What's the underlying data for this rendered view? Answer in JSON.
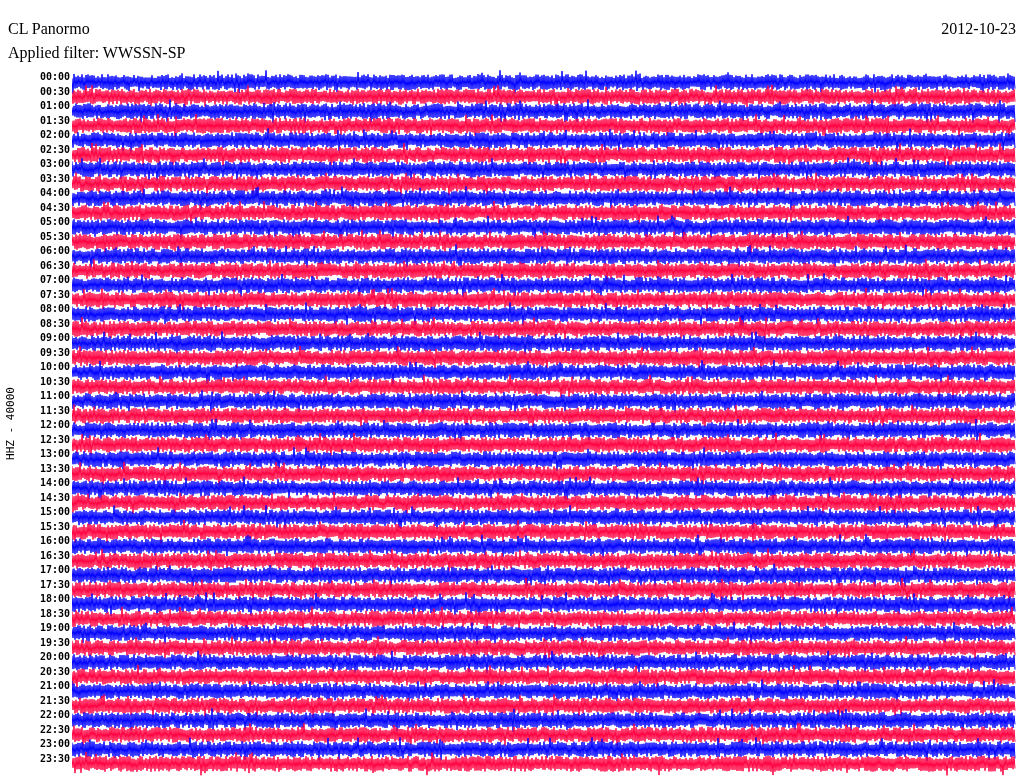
{
  "header": {
    "station": "CL Panormo",
    "date": "2012-10-23",
    "filter": "Applied filter: WWSSN-SP"
  },
  "axis_label": "HHZ - 40000",
  "rows": [
    {
      "label": "00:00",
      "color": "#0000ff"
    },
    {
      "label": "00:30",
      "color": "#ff0040"
    },
    {
      "label": "01:00",
      "color": "#0000ff"
    },
    {
      "label": "01:30",
      "color": "#ff0040"
    },
    {
      "label": "02:00",
      "color": "#0000ff"
    },
    {
      "label": "02:30",
      "color": "#ff0040"
    },
    {
      "label": "03:00",
      "color": "#0000ff"
    },
    {
      "label": "03:30",
      "color": "#ff0040"
    },
    {
      "label": "04:00",
      "color": "#0000ff"
    },
    {
      "label": "04:30",
      "color": "#ff0040"
    },
    {
      "label": "05:00",
      "color": "#0000ff"
    },
    {
      "label": "05:30",
      "color": "#ff0040"
    },
    {
      "label": "06:00",
      "color": "#0000ff"
    },
    {
      "label": "06:30",
      "color": "#ff0040"
    },
    {
      "label": "07:00",
      "color": "#0000ff"
    },
    {
      "label": "07:30",
      "color": "#ff0040"
    },
    {
      "label": "08:00",
      "color": "#0000ff"
    },
    {
      "label": "08:30",
      "color": "#ff0040"
    },
    {
      "label": "09:00",
      "color": "#0000ff"
    },
    {
      "label": "09:30",
      "color": "#ff0040"
    },
    {
      "label": "10:00",
      "color": "#0000ff"
    },
    {
      "label": "10:30",
      "color": "#ff0040"
    },
    {
      "label": "11:00",
      "color": "#0000ff"
    },
    {
      "label": "11:30",
      "color": "#ff0040"
    },
    {
      "label": "12:00",
      "color": "#0000ff"
    },
    {
      "label": "12:30",
      "color": "#ff0040"
    },
    {
      "label": "13:00",
      "color": "#0000ff"
    },
    {
      "label": "13:30",
      "color": "#ff0040"
    },
    {
      "label": "14:00",
      "color": "#0000ff"
    },
    {
      "label": "14:30",
      "color": "#ff0040"
    },
    {
      "label": "15:00",
      "color": "#0000ff"
    },
    {
      "label": "15:30",
      "color": "#ff0040"
    },
    {
      "label": "16:00",
      "color": "#0000ff"
    },
    {
      "label": "16:30",
      "color": "#ff0040"
    },
    {
      "label": "17:00",
      "color": "#0000ff"
    },
    {
      "label": "17:30",
      "color": "#ff0040"
    },
    {
      "label": "18:00",
      "color": "#0000ff"
    },
    {
      "label": "18:30",
      "color": "#ff0040"
    },
    {
      "label": "19:00",
      "color": "#0000ff"
    },
    {
      "label": "19:30",
      "color": "#ff0040"
    },
    {
      "label": "20:00",
      "color": "#0000ff"
    },
    {
      "label": "20:30",
      "color": "#ff0040"
    },
    {
      "label": "21:00",
      "color": "#0000ff"
    },
    {
      "label": "21:30",
      "color": "#ff0040"
    },
    {
      "label": "22:00",
      "color": "#0000ff"
    },
    {
      "label": "22:30",
      "color": "#ff0040"
    },
    {
      "label": "23:00",
      "color": "#0000ff"
    },
    {
      "label": "23:30",
      "color": "#ff0040"
    }
  ]
}
